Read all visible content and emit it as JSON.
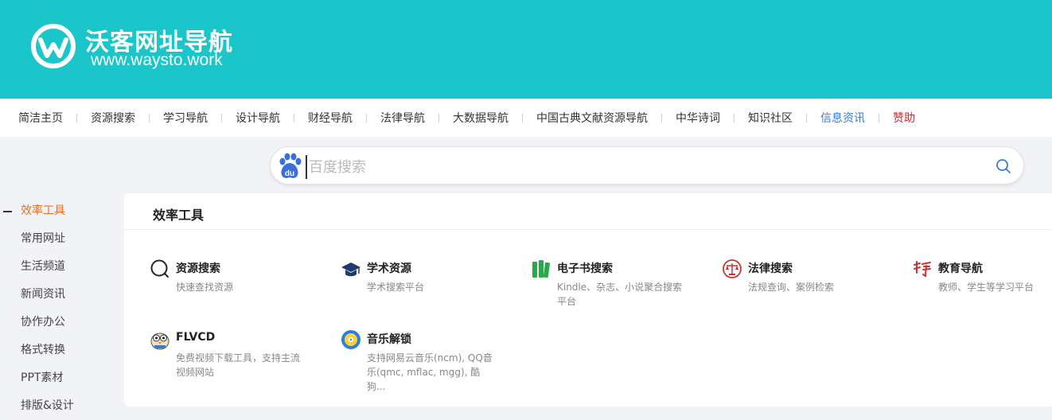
{
  "brand": {
    "title": "沃客网址导航",
    "url": "www.waysto.work",
    "color": "#1ac6c9"
  },
  "nav": {
    "items": [
      {
        "label": "简洁主页"
      },
      {
        "label": "资源搜索"
      },
      {
        "label": "学习导航"
      },
      {
        "label": "设计导航"
      },
      {
        "label": "财经导航"
      },
      {
        "label": "法律导航"
      },
      {
        "label": "大数据导航"
      },
      {
        "label": "中国古典文献资源导航"
      },
      {
        "label": "中华诗词"
      },
      {
        "label": "知识社区"
      },
      {
        "label": "信息资讯"
      },
      {
        "label": "赞助"
      }
    ]
  },
  "search": {
    "engine_icon": "baidu-paw-icon",
    "placeholder": "百度搜索",
    "value": "",
    "button_icon": "search-icon"
  },
  "sidebar": {
    "items": [
      {
        "label": "效率工具",
        "active": true
      },
      {
        "label": "常用网址"
      },
      {
        "label": "生活频道"
      },
      {
        "label": "新闻资讯"
      },
      {
        "label": "协作办公"
      },
      {
        "label": "格式转换"
      },
      {
        "label": "PPT素材"
      },
      {
        "label": "排版&设计"
      }
    ]
  },
  "section": {
    "title": "效率工具",
    "cards": [
      {
        "name": "资源搜索",
        "desc": "快速查找资源",
        "icon": "search-circle-icon"
      },
      {
        "name": "学术资源",
        "desc": "学术搜索平台",
        "icon": "graduation-cap-icon"
      },
      {
        "name": "电子书搜索",
        "desc": "Kindle、杂志、小说聚合搜索平台",
        "icon": "books-icon"
      },
      {
        "name": "法律搜索",
        "desc": "法规查询、案例检索",
        "icon": "law-scale-icon"
      },
      {
        "name": "教育导航",
        "desc": "教师、学生等学习平台",
        "icon": "calligraphy-icon"
      },
      {
        "name": "FLVCD",
        "desc": "免费视频下载工具，支持主流视频网站",
        "icon": "owl-icon"
      },
      {
        "name": "音乐解锁",
        "desc": "支持网易云音乐(ncm), QQ音乐(qmc, mflac, mgg), 酷狗...",
        "icon": "music-unlock-icon"
      }
    ]
  }
}
